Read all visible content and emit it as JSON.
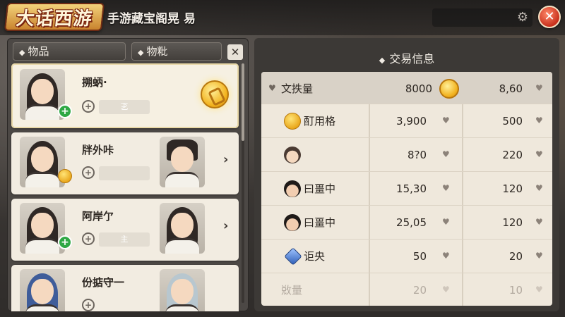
{
  "app": {
    "logo_text": "大话西游",
    "title": "手游藏宝阁晃 易"
  },
  "top": {
    "gear_icon": "gear-icon",
    "close_glyph": "✕"
  },
  "left": {
    "tabs": [
      {
        "label": "物品"
      },
      {
        "label": "物粃"
      }
    ],
    "close_glyph": "✕",
    "cards": [
      {
        "name": "搠蛃·",
        "chip": "乤",
        "badge": "plus",
        "selected": true,
        "has_coin": true
      },
      {
        "name": "牉外咔",
        "chip": "",
        "badge": "coin",
        "selected": false,
        "has_coin": false
      },
      {
        "name": "阿岸亇",
        "chip": "主",
        "badge": "plus",
        "selected": false,
        "has_coin": false
      },
      {
        "name": "份掂守一",
        "chip": "",
        "badge": "none",
        "selected": false,
        "has_coin": false
      }
    ],
    "arrow_glyph": "›",
    "chip_icon_glyph": "+"
  },
  "right": {
    "title": "交易信息",
    "header": {
      "label": "文抶量",
      "v1": "8000",
      "v2": "8,60"
    },
    "rows": [
      {
        "icon": "coin-icon",
        "label": "酊用格",
        "v1": "3,900",
        "v2": "500"
      },
      {
        "icon": "character-face-icon",
        "label": "",
        "v1": "8?0",
        "v2": "220"
      },
      {
        "icon": "character-face-icon",
        "label": "曰畺中",
        "v1": "15,30",
        "v2": "120"
      },
      {
        "icon": "character-face-icon",
        "label": "曰畺中",
        "v1": "25,05",
        "v2": "120"
      },
      {
        "icon": "gem-icon",
        "label": "讵央",
        "v1": "50",
        "v2": "20"
      },
      {
        "icon": "",
        "label": "敚量",
        "v1": "20",
        "v2": "10"
      }
    ],
    "heart_glyph": "♥"
  }
}
